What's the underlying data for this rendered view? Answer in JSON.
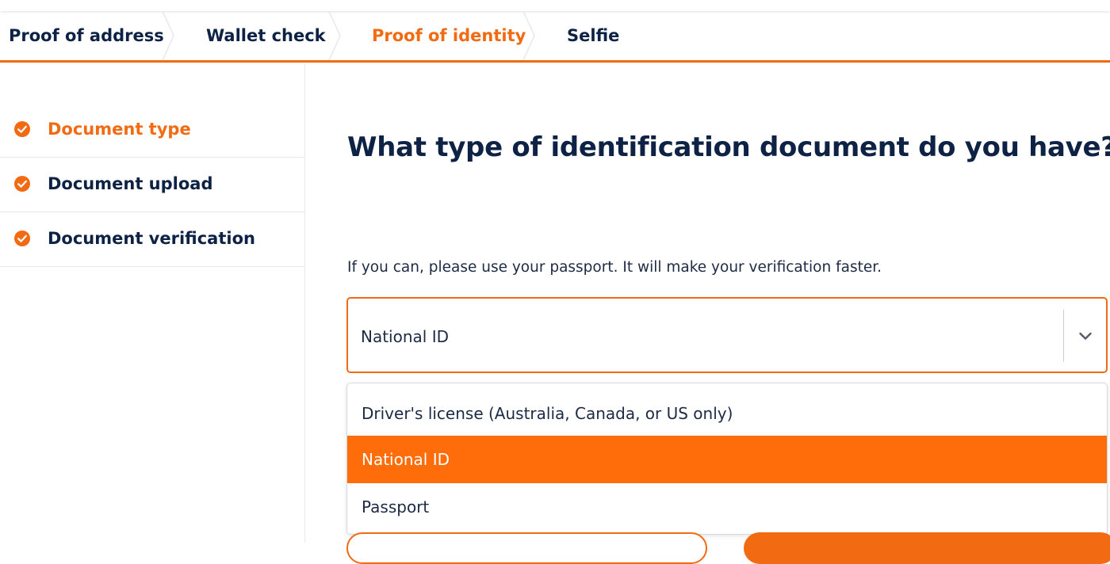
{
  "steps": {
    "items": [
      {
        "label": "Proof of address"
      },
      {
        "label": "Wallet check"
      },
      {
        "label": "Proof of identity"
      },
      {
        "label": "Selfie"
      }
    ],
    "active_index": 2
  },
  "sidebar": {
    "items": [
      {
        "label": "Document type",
        "icon": "check-circle-icon",
        "active": true
      },
      {
        "label": "Document upload",
        "icon": "check-circle-icon",
        "active": false
      },
      {
        "label": "Document verification",
        "icon": "check-circle-icon",
        "active": false
      }
    ]
  },
  "main": {
    "heading": "What type of identification document do you have?",
    "hint": "If you can, please use your passport. It will make your verification faster.",
    "select": {
      "value": "National ID",
      "icon": "chevron-down-icon",
      "options": [
        {
          "label": "Driver's license (Australia, Canada, or US only)"
        },
        {
          "label": "National ID"
        },
        {
          "label": "Passport"
        }
      ],
      "selected_index": 1
    }
  },
  "colors": {
    "accent": "#f26a12",
    "highlight": "#ff6c0a",
    "navy": "#0d2244",
    "divider": "#e6e8ec"
  }
}
